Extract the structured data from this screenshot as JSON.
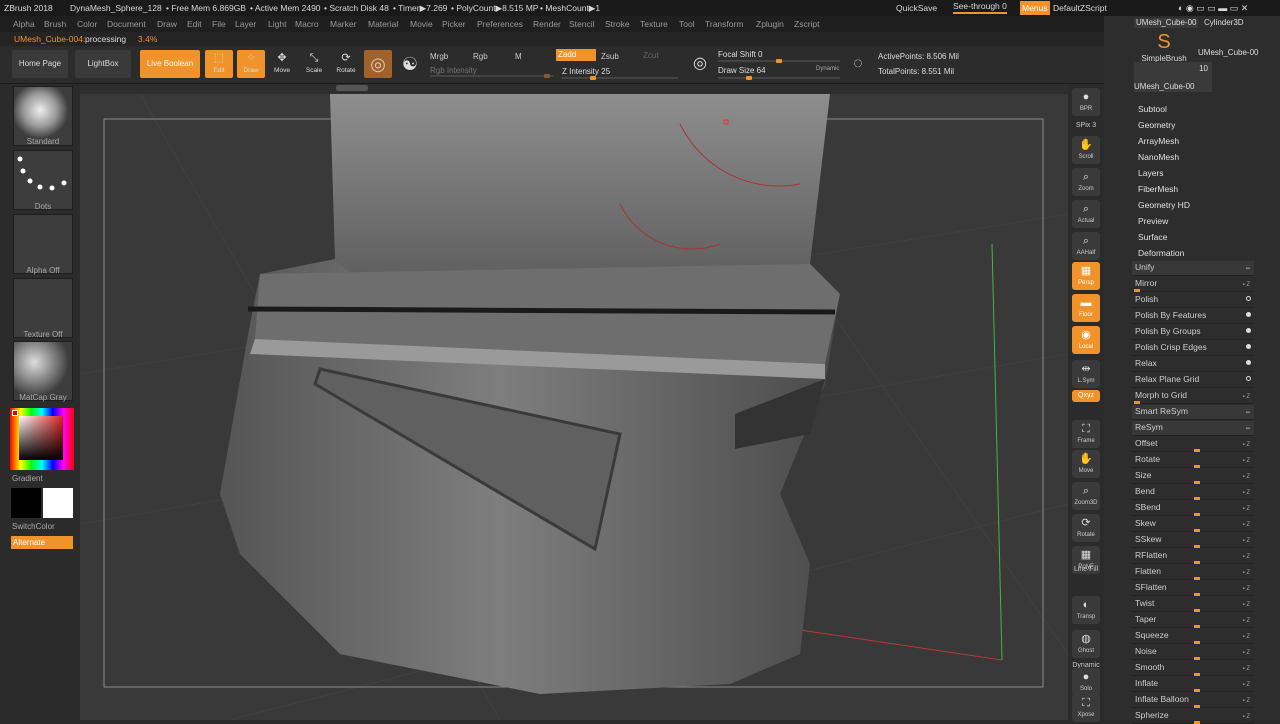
{
  "titlebar": {
    "app": "ZBrush 2018",
    "document": "DynaMesh_Sphere_128",
    "free_mem": "• Free Mem 6.869GB",
    "active_mem": "• Active Mem 2490",
    "scratch": "• Scratch Disk 48",
    "timer": "• Timer▶7.269",
    "polycount": "• PolyCount▶8.515 MP",
    "meshcount": "• MeshCount▶1",
    "quicksave": "QuickSave",
    "see_through": "See-through  0",
    "menus": "Menus",
    "script": "DefaultZScript"
  },
  "menu": [
    "Alpha",
    "Brush",
    "Color",
    "Document",
    "Draw",
    "Edit",
    "File",
    "Layer",
    "Light",
    "Macro",
    "Marker",
    "Material",
    "Movie",
    "Picker",
    "Preferences",
    "Render",
    "Stencil",
    "Stroke",
    "Texture",
    "Tool",
    "Transform",
    "Zplugin",
    "Zscript"
  ],
  "status": {
    "name": "UMesh_Cube-004:",
    "state": "processing",
    "percent": "3.4%"
  },
  "toolbar": {
    "home": "Home Page",
    "lightbox": "LightBox",
    "liveboolean": "Live Boolean",
    "edit": "Edit",
    "draw": "Draw",
    "move": "Move",
    "scale": "Scale",
    "rotate": "Rotate",
    "mrgb": "Mrgb",
    "rgb": "Rgb",
    "m": "M",
    "zadd": "Zadd",
    "zsub": "Zsub",
    "zcut": "Zcut",
    "rgb_intensity": "Rgb Intensity",
    "z_intensity": "Z Intensity 25",
    "focal_shift": "Focal Shift 0",
    "draw_size": "Draw Size 64",
    "dynamic": "Dynamic",
    "active_points": "ActivePoints: 8.506 Mil",
    "total_points": "TotalPoints: 8.551 Mil",
    "z_intensity_level": 0.25,
    "focal_shift_level": 0.5,
    "draw_size_level": 0.1
  },
  "left": {
    "standard": "Standard",
    "dots": "Dots",
    "alpha": "Alpha Off",
    "texture": "Texture Off",
    "matcap": "MatCap Gray",
    "gradient": "Gradient",
    "switchcolor": "SwitchColor",
    "alternate": "Alternate"
  },
  "shelf": [
    {
      "label": "BPR",
      "icon": "●"
    },
    {
      "label": "SPix 3",
      "icon": ""
    },
    {
      "label": "Scroll",
      "icon": "✋"
    },
    {
      "label": "Zoom",
      "icon": "⌕"
    },
    {
      "label": "Actual",
      "icon": "⌕"
    },
    {
      "label": "AAHalf",
      "icon": "⌕"
    },
    {
      "label": "Persp",
      "icon": "▦"
    },
    {
      "label": "Floor",
      "icon": "▬"
    },
    {
      "label": "Local",
      "icon": "◉"
    },
    {
      "label": "L.Sym",
      "icon": "⇹"
    },
    {
      "label": "Qxyz",
      "icon": ""
    },
    {
      "label": "Frame",
      "icon": "⛶"
    },
    {
      "label": "Move",
      "icon": "✋"
    },
    {
      "label": "Zoom3D",
      "icon": "⌕"
    },
    {
      "label": "Rotate",
      "icon": "⟳"
    },
    {
      "label": "PolyF",
      "icon": "▦"
    },
    {
      "label": "Line Fill",
      "icon": ""
    },
    {
      "label": "Transp",
      "icon": "◐"
    },
    {
      "label": "Ghost",
      "icon": "◍"
    },
    {
      "label": "Dynamic",
      "icon": ""
    },
    {
      "label": "Solo",
      "icon": "●"
    },
    {
      "label": "Xpose",
      "icon": "⛶"
    }
  ],
  "right": {
    "tools": {
      "t1": "UMesh_Cube-00",
      "t2": "Cylinder3D",
      "t3": "SimpleBrush",
      "t4": "UMesh_Cube-00",
      "count": "10",
      "t5": "UMesh_Cube-00"
    },
    "sections": [
      "Subtool",
      "Geometry",
      "ArrayMesh",
      "NanoMesh",
      "Layers",
      "FiberMesh",
      "Geometry HD",
      "Preview",
      "Surface",
      "Deformation"
    ],
    "deformation": [
      "Unify",
      "Mirror",
      "Polish",
      "Polish By Features",
      "Polish By Groups",
      "Polish Crisp Edges",
      "Relax",
      "Relax Plane Grid",
      "Morph to Grid",
      "Smart ReSym",
      "ReSym",
      "Offset",
      "Rotate",
      "Size",
      "Bend",
      "SBend",
      "Skew",
      "SSkew",
      "RFlatten",
      "Flatten",
      "SFlatten",
      "Twist",
      "Taper",
      "Squeeze",
      "Noise",
      "Smooth",
      "Inflate",
      "Inflate Balloon",
      "Spherize"
    ]
  },
  "colors": {
    "accent": "#f0932a",
    "bg": "#2b2b2b",
    "viewport": "#393939"
  }
}
